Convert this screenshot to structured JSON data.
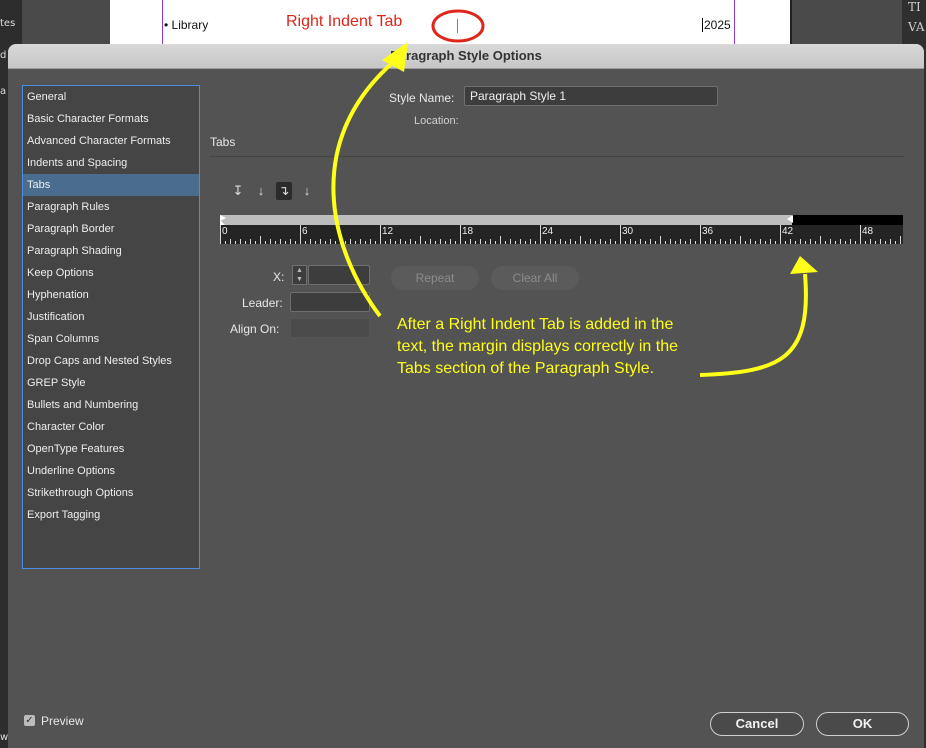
{
  "background": {
    "side_labels": [
      "tes",
      "d",
      "a",
      "w"
    ],
    "doc_bullet_text": "• Library",
    "doc_year": "2025",
    "right_panel_glyphs": [
      "TI",
      "VA"
    ]
  },
  "dialog": {
    "title": "Paragraph Style Options",
    "sidebar_items": [
      "General",
      "Basic Character Formats",
      "Advanced Character Formats",
      "Indents and Spacing",
      "Tabs",
      "Paragraph Rules",
      "Paragraph Border",
      "Paragraph Shading",
      "Keep Options",
      "Hyphenation",
      "Justification",
      "Span Columns",
      "Drop Caps and Nested Styles",
      "GREP Style",
      "Bullets and Numbering",
      "Character Color",
      "OpenType Features",
      "Underline Options",
      "Strikethrough Options",
      "Export Tagging"
    ],
    "selected_item": "Tabs",
    "style_name_label": "Style Name:",
    "style_name_value": "Paragraph Style 1",
    "location_label": "Location:",
    "section_title": "Tabs",
    "tab_buttons": [
      "left-tab-icon",
      "center-tab-icon",
      "right-tab-icon",
      "decimal-tab-icon"
    ],
    "ruler_labels": [
      "0",
      "6",
      "12",
      "18",
      "24",
      "30",
      "36",
      "42",
      "48"
    ],
    "x_label": "X:",
    "leader_label": "Leader:",
    "align_on_label": "Align On:",
    "repeat_label": "Repeat",
    "clear_all_label": "Clear All",
    "preview_label": "Preview",
    "preview_checked": true,
    "cancel_label": "Cancel",
    "ok_label": "OK"
  },
  "annotations": {
    "callout_top": "Right Indent Tab",
    "callout_body_lines": [
      "After a Right Indent Tab is added in the",
      "text, the margin displays correctly in the",
      "Tabs section of the Paragraph Style."
    ],
    "colors": {
      "red": "#e0261b",
      "yellow": "#ffff1a"
    }
  }
}
